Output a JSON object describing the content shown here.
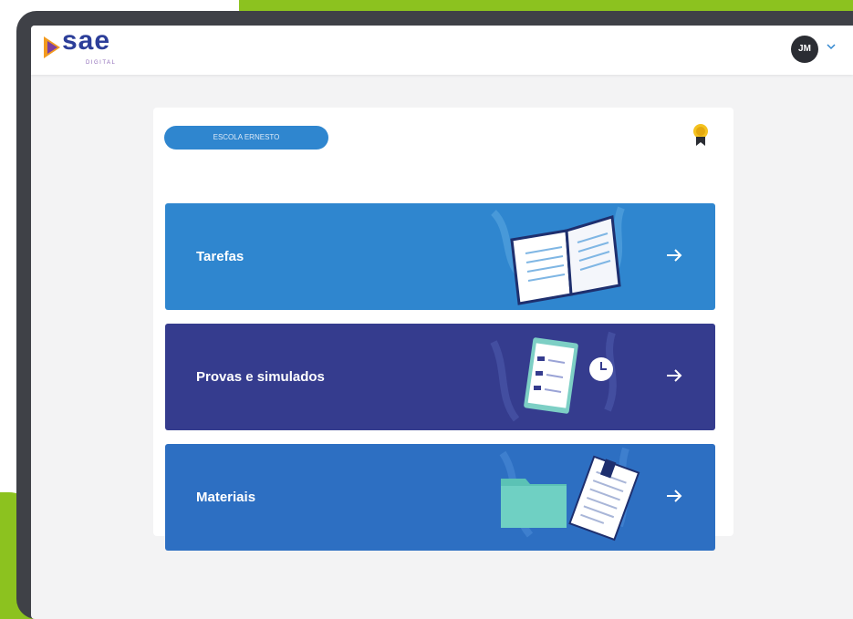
{
  "header": {
    "logo_text": "sae",
    "logo_subtext": "DIGITAL",
    "avatar_initials": "JM"
  },
  "card": {
    "school_name": "ESCOLA ERNESTO",
    "tiles": [
      {
        "label": "Tarefas",
        "color": "#2f86cf",
        "icon": "open-book-illustration"
      },
      {
        "label": "Provas e simulados",
        "color": "#353c8e",
        "icon": "clipboard-checklist-illustration"
      },
      {
        "label": "Materiais",
        "color": "#2d6fc2",
        "icon": "folder-document-illustration"
      }
    ]
  },
  "colors": {
    "brand_green": "#8cc21f",
    "brand_blue": "#2c3e99",
    "device_frame": "#3f4147"
  }
}
